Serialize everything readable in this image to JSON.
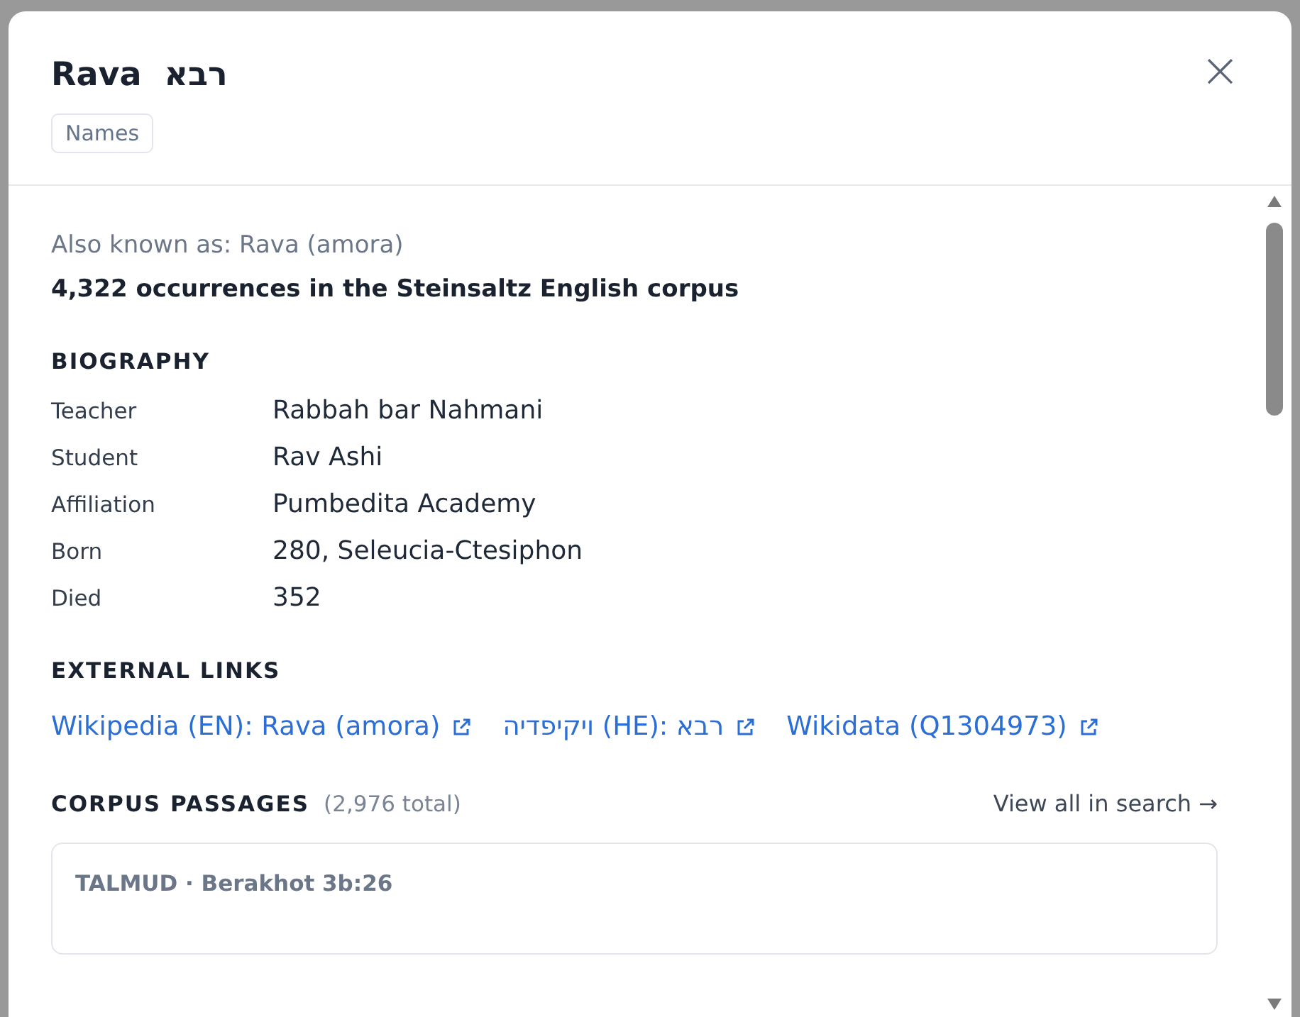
{
  "modal": {
    "title": "Rava",
    "title_hebrew": "רבא",
    "close": "×",
    "tags": [
      "Names"
    ]
  },
  "also_known_as": "Also known as: Rava (amora)",
  "occurrences": "4,322 occurrences in the Steinsaltz English corpus",
  "biography": {
    "heading": "BIOGRAPHY",
    "rows": [
      {
        "label": "Teacher",
        "value": "Rabbah bar Nahmani"
      },
      {
        "label": "Student",
        "value": "Rav Ashi"
      },
      {
        "label": "Affiliation",
        "value": "Pumbedita Academy"
      },
      {
        "label": "Born",
        "value": "280, Seleucia-Ctesiphon"
      },
      {
        "label": "Died",
        "value": "352"
      }
    ]
  },
  "external_links": {
    "heading": "EXTERNAL LINKS",
    "links": [
      {
        "label": "Wikipedia (EN): Rava (amora)"
      },
      {
        "label": "ויקיפדיה (HE): רבא"
      },
      {
        "label": "Wikidata (Q1304973)"
      }
    ]
  },
  "corpus_passages": {
    "heading": "CORPUS PASSAGES",
    "total": "(2,976 total)",
    "view_all": "View all in search →",
    "passages": [
      {
        "source": "TALMUD · Berakhot 3b:26"
      }
    ]
  }
}
